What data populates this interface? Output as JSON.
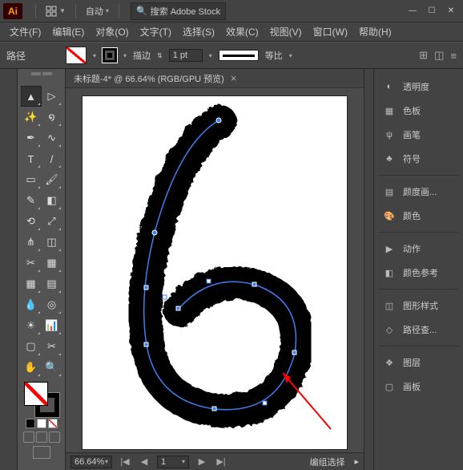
{
  "titlebar": {
    "logo": "Ai",
    "layout_label": "自动",
    "search_placeholder": "搜索 Adobe Stock"
  },
  "menu": {
    "items": [
      "文件(F)",
      "编辑(E)",
      "对象(O)",
      "文字(T)",
      "选择(S)",
      "效果(C)",
      "视图(V)",
      "窗口(W)",
      "帮助(H)"
    ]
  },
  "controlbar": {
    "object_type": "路径",
    "stroke_label": "描边",
    "stroke_weight": "1 pt",
    "variable_label": "等比"
  },
  "document": {
    "tab_title": "未标题-4* @ 66.64% (RGB/GPU 预览)"
  },
  "statusbar": {
    "zoom": "66.64%",
    "artboard": "1",
    "selection": "编组选择"
  },
  "panels": [
    {
      "icon": "transparency",
      "label": "透明度"
    },
    {
      "icon": "swatches",
      "label": "色板"
    },
    {
      "icon": "brushes",
      "label": "画笔"
    },
    {
      "icon": "symbols",
      "label": "符号"
    },
    {
      "icon": "",
      "sep": true
    },
    {
      "icon": "gradient",
      "label": "颜度画..."
    },
    {
      "icon": "color",
      "label": "颜色"
    },
    {
      "icon": "",
      "sep": true
    },
    {
      "icon": "actions",
      "label": "动作"
    },
    {
      "icon": "colorguide",
      "label": "颜色参考"
    },
    {
      "icon": "",
      "sep": true
    },
    {
      "icon": "graphicstyles",
      "label": "图形样式"
    },
    {
      "icon": "pathfinder",
      "label": "路径查..."
    },
    {
      "icon": "",
      "sep": true
    },
    {
      "icon": "layers",
      "label": "图层"
    },
    {
      "icon": "artboards",
      "label": "画板"
    }
  ],
  "tools": [
    [
      "selection",
      "▲",
      "direct",
      "▷"
    ],
    [
      "wand",
      "✨",
      "lasso",
      "໑"
    ],
    [
      "pen",
      "✒",
      "curve",
      "∿"
    ],
    [
      "type",
      "T",
      "line",
      "/"
    ],
    [
      "rect",
      "▭",
      "brush",
      "🖌"
    ],
    [
      "pencil",
      "✎",
      "eraser",
      "◧"
    ],
    [
      "rotate",
      "⟲",
      "scale",
      "⤢"
    ],
    [
      "width",
      "⋔",
      "free",
      "◫"
    ],
    [
      "shapebuild",
      "✂",
      "persp",
      "▦"
    ],
    [
      "mesh",
      "▦",
      "gradient",
      "▤"
    ],
    [
      "eyedrop",
      "💧",
      "blend",
      "◎"
    ],
    [
      "symbol",
      "☀",
      "graph",
      "📊"
    ],
    [
      "artboard",
      "▢",
      "slice",
      "✂"
    ],
    [
      "hand",
      "✋",
      "zoom",
      "🔍"
    ]
  ]
}
